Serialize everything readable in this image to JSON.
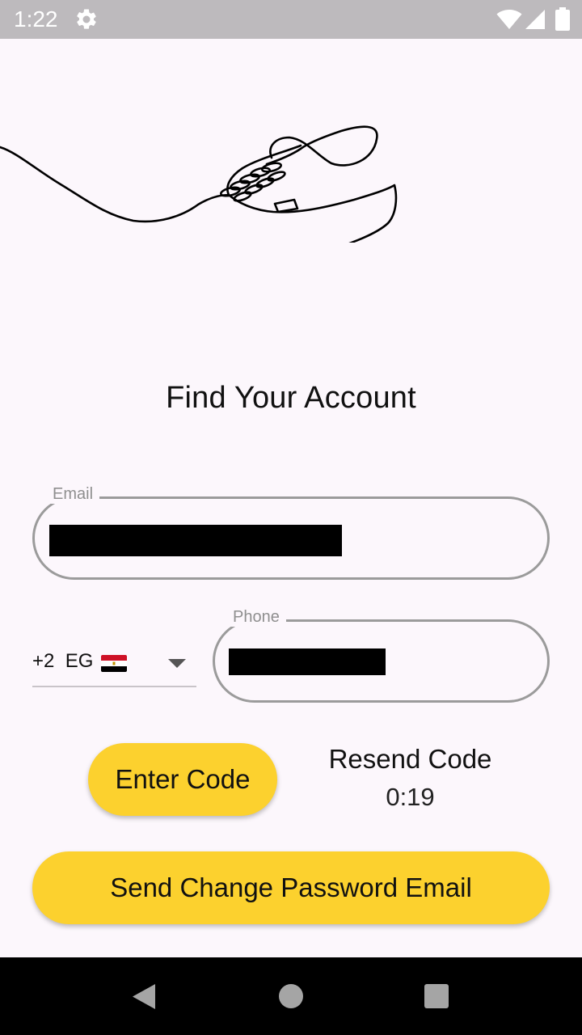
{
  "status_bar": {
    "time": "1:22",
    "icons": [
      "gear-icon",
      "wifi-icon",
      "cell-signal-icon",
      "battery-icon"
    ],
    "background": "#bdbabd"
  },
  "illustration": {
    "icon": "sneaker-line-art-icon"
  },
  "page": {
    "title": "Find Your Account",
    "background": "#fcf7fc"
  },
  "email_field": {
    "label": "Email"
  },
  "phone": {
    "country_code": "+2",
    "country": "EG",
    "flag_icon": "egypt-flag-icon",
    "dropdown_icon": "caret-down-icon",
    "field_label": "Phone"
  },
  "actions": {
    "enter_code_label": "Enter Code",
    "resend_label": "Resend Code",
    "resend_timer": "0:19",
    "send_email_label": "Send Change Password Email",
    "accent_color": "#fcd12e"
  },
  "nav_bar": {
    "icons": [
      "back-icon",
      "home-icon",
      "recent-apps-icon"
    ]
  }
}
